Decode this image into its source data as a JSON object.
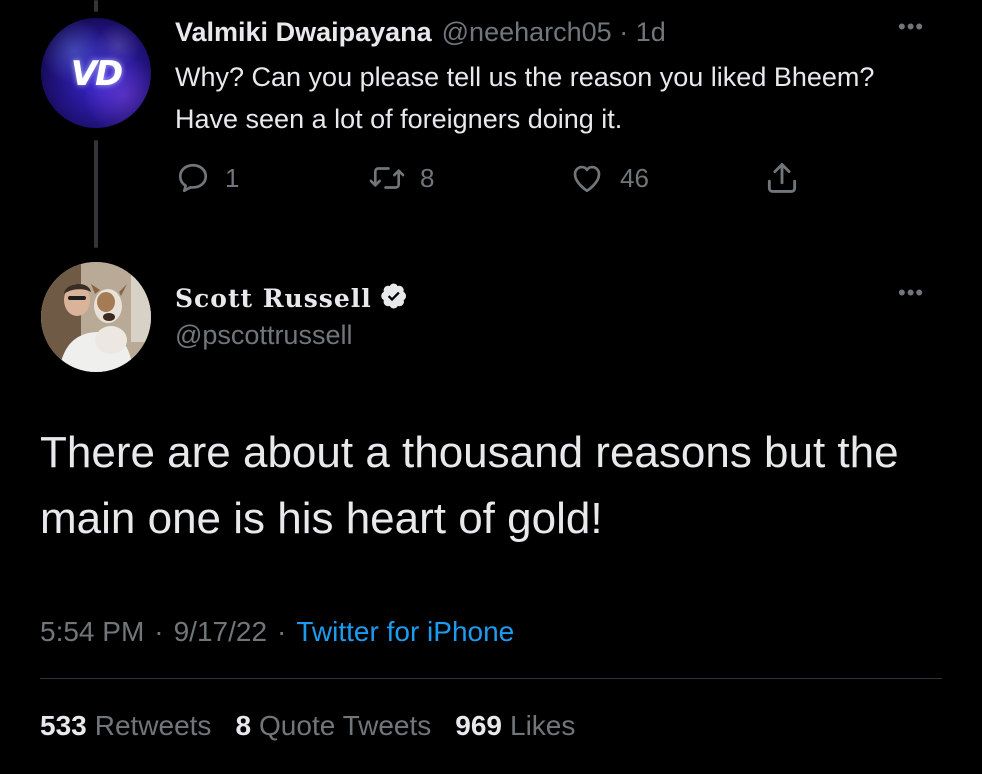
{
  "parent_tweet": {
    "display_name": "Valmiki Dwaipayana",
    "handle": "@neeharch05",
    "separator": "·",
    "age": "1d",
    "text": "Why? Can you please tell us the reason you liked Bheem? Have seen a lot of foreigners doing it.",
    "avatar_text": "VD",
    "more": "•••",
    "actions": {
      "reply_count": "1",
      "retweet_count": "8",
      "like_count": "46"
    }
  },
  "main_tweet": {
    "display_name": "Scott Russell",
    "handle": "@pscottrussell",
    "more": "•••",
    "text": "There are about a thousand reasons but the main one is his heart of gold!",
    "time": "5:54 PM",
    "date": "9/17/22",
    "separator": "·",
    "source": "Twitter for iPhone",
    "stats": {
      "retweets_num": "533",
      "retweets_label": "Retweets",
      "quotes_num": "8",
      "quotes_label": "Quote Tweets",
      "likes_num": "969",
      "likes_label": "Likes"
    }
  },
  "colors": {
    "background": "#000000",
    "text_primary": "#e7e9ea",
    "text_secondary": "#71767b",
    "link": "#1d9bf0"
  },
  "icons": [
    "reply-icon",
    "retweet-icon",
    "like-icon",
    "share-icon",
    "verified-badge-icon",
    "more-icon"
  ]
}
